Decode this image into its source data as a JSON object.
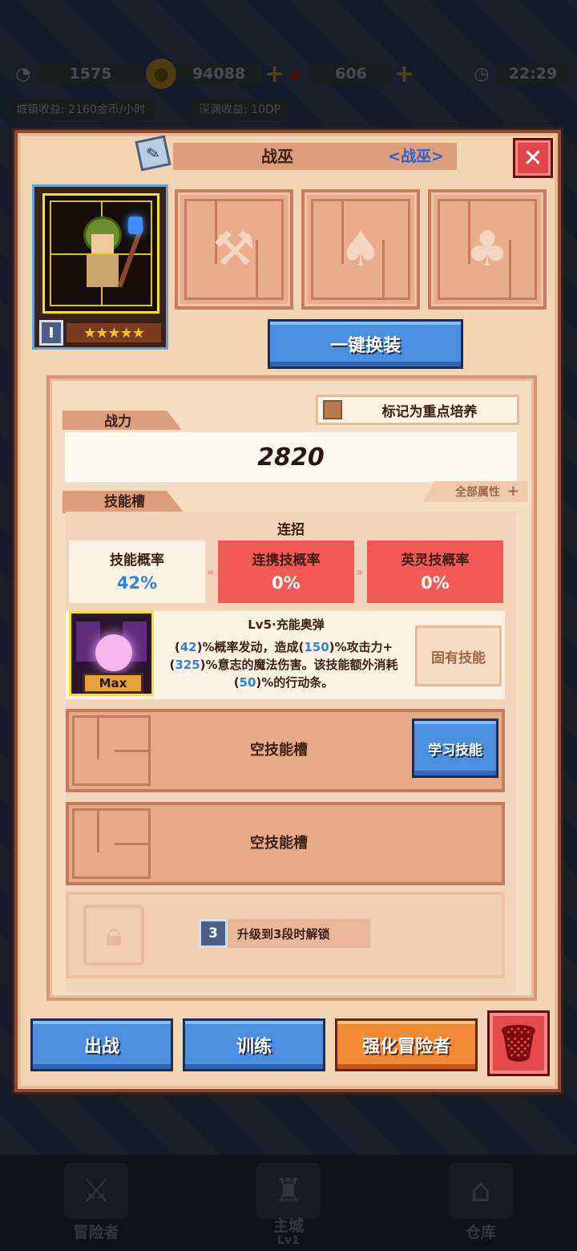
{
  "top_bar": {
    "energy_value": "1575",
    "gold_value": "94088",
    "gem_value": "606",
    "clock_time": "22:29",
    "town_income": "城镇收益: 2160金币/小时",
    "abyss_income": "深渊收益: 10DP"
  },
  "dialog": {
    "hero_name": "战巫",
    "hero_class": "<战巫>",
    "close_symbol": "✕",
    "rank_numeral": "I",
    "stars": "★★★★★",
    "equip_button": "一键换装",
    "focus_label": "标记为重点培养",
    "power_tab": "战力",
    "power_value": "2820",
    "all_attributes": "全部属性",
    "skills_tab": "技能槽",
    "combo": {
      "title": "连招",
      "cards": [
        {
          "label": "技能概率",
          "value": "42%",
          "color": "#2e82e8"
        },
        {
          "label": "连携技概率",
          "value": "0%",
          "color": "#ffffff"
        },
        {
          "label": "英灵技概率",
          "value": "0%",
          "color": "#ffffff"
        }
      ]
    },
    "skill": {
      "name": "Lv5·充能奥弹",
      "max_tag": "Max",
      "desc_parts": [
        "(",
        "42",
        ")%概率发动，造成(",
        "150",
        ")%攻击力+ (",
        "325",
        ")%意志的魔法伤害。该技能额外消耗(",
        "50",
        ")%的行动条。"
      ],
      "innate_label": "固有技能"
    },
    "empty_slots": [
      {
        "label": "空技能槽",
        "button": "学习技能"
      },
      {
        "label": "空技能槽"
      }
    ],
    "locked_slot": {
      "badge": "3",
      "text": "升级到3段时解锁"
    },
    "buttons": {
      "deploy": "出战",
      "train": "训练",
      "enhance": "强化冒险者"
    }
  },
  "bottom_nav": [
    {
      "label": "冒险者",
      "icon": "adventurer-icon"
    },
    {
      "label": "主城",
      "sub": "Lv1",
      "icon": "castle-icon"
    },
    {
      "label": "仓库",
      "icon": "warehouse-icon"
    }
  ]
}
